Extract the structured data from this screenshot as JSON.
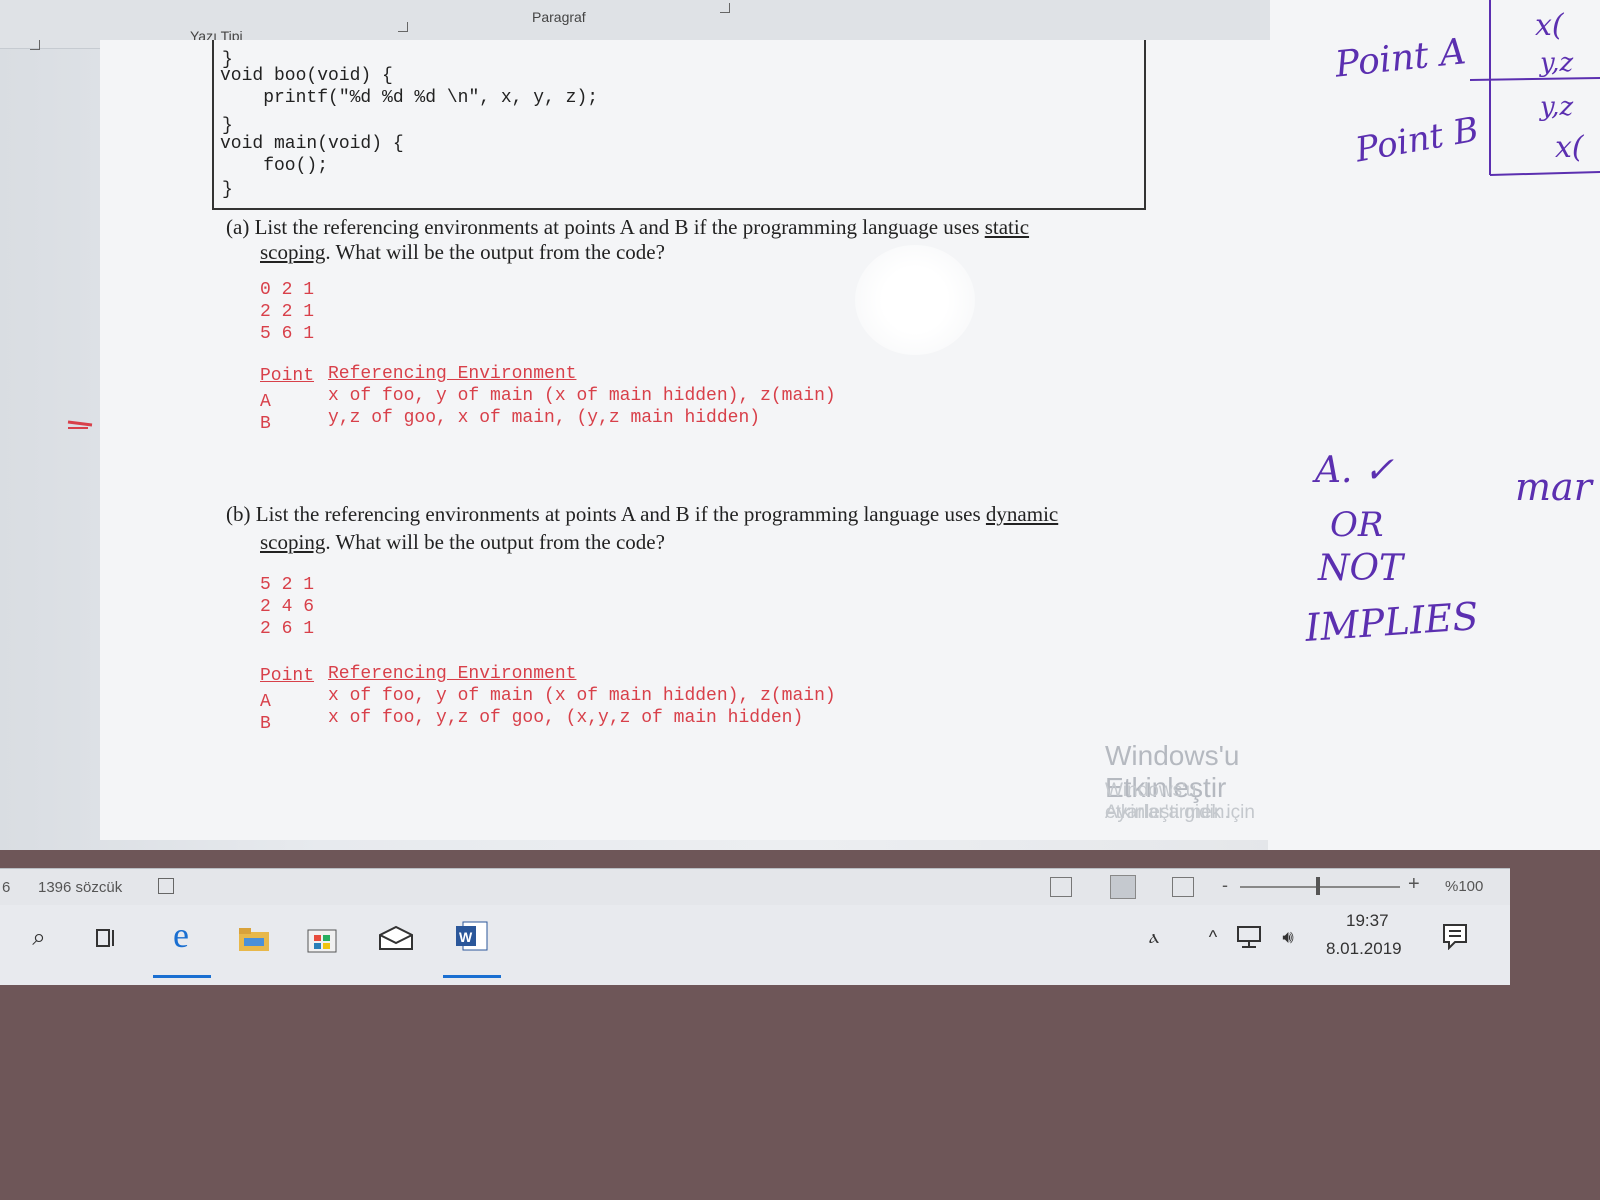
{
  "ribbon": {
    "font_group": "Yazı Tipi",
    "paragraph_group": "Paragraf"
  },
  "code": {
    "line1": "}",
    "line2": "void boo(void) {",
    "line3": "    printf(\"%d %d %d \\n\", x, y, z);",
    "line4": "}",
    "line5": "void main(void) {",
    "line6": "    foo();",
    "line7": "}"
  },
  "question_a": {
    "label": "(a)",
    "text1": "List the referencing environments at points A and B if the programming language uses",
    "keyword1": "static",
    "keyword2": "scoping",
    "text2": ". What will be the output from the code?",
    "output": [
      "0 2 1",
      "2 2 1",
      "5 6 1"
    ],
    "header_point": "Point",
    "header_env": "Referencing Environment",
    "row_a_point": "A",
    "row_a_env": "x of foo, y of main (x of main hidden), z(main)",
    "row_b_point": "B",
    "row_b_env": "y,z of goo, x of main, (y,z main hidden)"
  },
  "question_b": {
    "label": "(b)",
    "text1": "List the referencing environments at points A and B if the programming language uses",
    "keyword1": "dynamic",
    "keyword2": "scoping",
    "text2": ". What will be the output from the code?",
    "output": [
      "5 2 1",
      "2 4 6",
      "2 6 1"
    ],
    "header_point": "Point",
    "header_env": "Referencing Environment",
    "row_a_point": "A",
    "row_a_env": "x of foo, y of main (x of main hidden), z(main)",
    "row_b_point": "B",
    "row_b_env": "x of foo, y,z of goo, (x,y,z of main hidden)"
  },
  "handwriting": {
    "point_a": "Point A",
    "point_b": "Point B",
    "col1": "x(",
    "col2": "y,z",
    "col3": "y,z",
    "col4": "x(",
    "a_mark": "A. ✓",
    "or": "OR",
    "not": "NOT",
    "implies": "IMPLIES",
    "mar": "mar"
  },
  "watermark": {
    "title": "Windows'u Etkinleştir",
    "subtitle1": "Windows'u etkinleştirmek için",
    "subtitle2": "Ayarlar'a gidin."
  },
  "statusbar": {
    "page_fragment": "6",
    "word_count": "1396 sözcük",
    "zoom": "%100"
  },
  "tray": {
    "time": "19:37",
    "date": "8.01.2019"
  }
}
